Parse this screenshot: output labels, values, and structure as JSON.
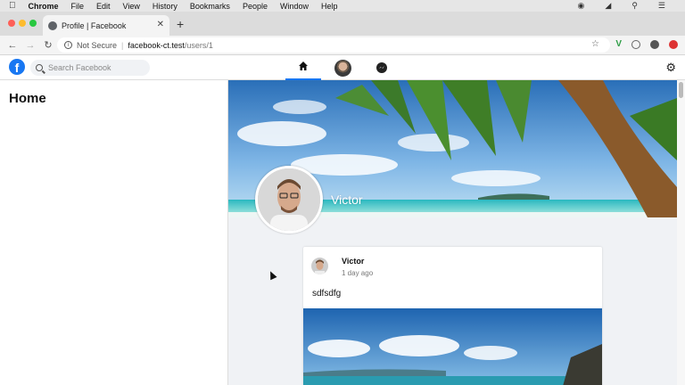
{
  "menubar": {
    "app": "Chrome",
    "items": [
      "File",
      "Edit",
      "View",
      "History",
      "Bookmarks",
      "People",
      "Window",
      "Help"
    ]
  },
  "tab": {
    "title": "Profile | Facebook",
    "close": "✕",
    "new": "+"
  },
  "toolbar": {
    "not_secure": "Not Secure",
    "url_host": "facebook-ct.test",
    "url_path": "/users/1"
  },
  "fb_header": {
    "search_placeholder": "Search Facebook"
  },
  "sidebar": {
    "title": "Home"
  },
  "profile": {
    "name": "Victor"
  },
  "post": {
    "author": "Victor",
    "time": "1 day ago",
    "body": "sdfsdfg"
  },
  "colors": {
    "facebook_blue": "#1877f2",
    "page_bg": "#f0f2f5"
  },
  "icons": [
    "apple-icon",
    "search-icon",
    "home-icon",
    "messenger-icon",
    "gear-icon",
    "star-icon"
  ]
}
